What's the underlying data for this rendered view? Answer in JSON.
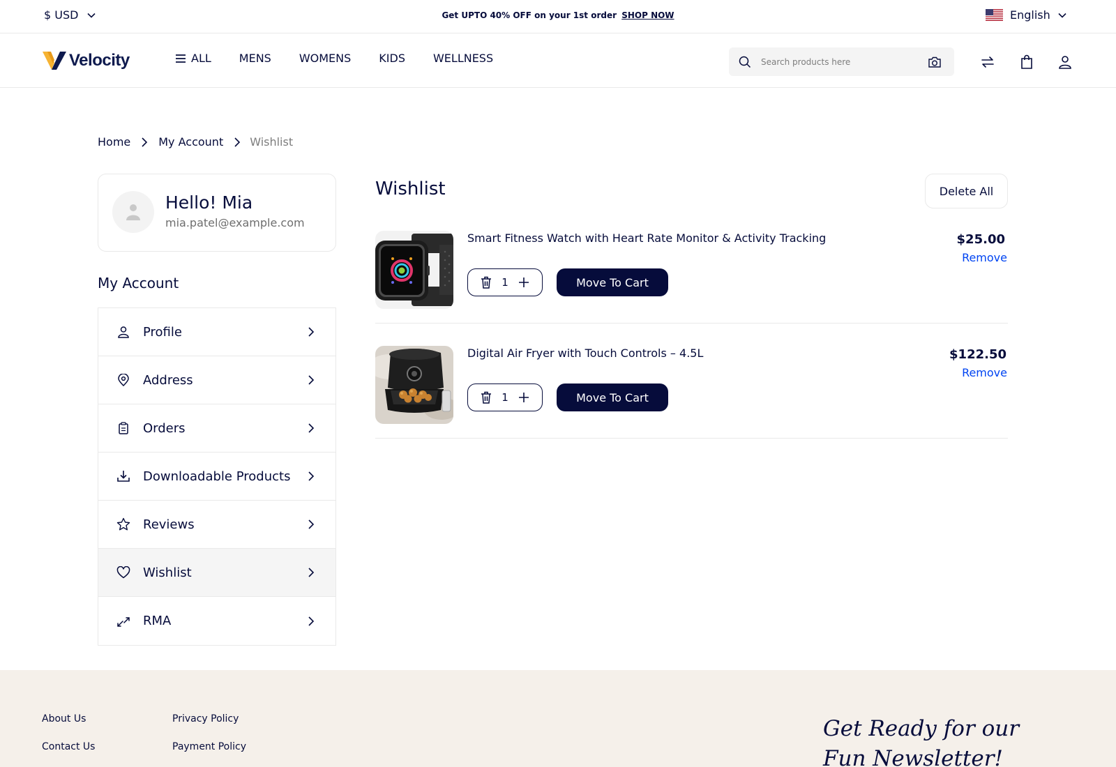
{
  "topbar": {
    "currency": "$ USD",
    "promo_text": "Get UPTO 40% OFF on your 1st order",
    "promo_link": "SHOP NOW",
    "language": "English"
  },
  "header": {
    "logo_text": "Velocity",
    "nav": [
      "ALL",
      "MENS",
      "WOMENS",
      "KIDS",
      "WELLNESS"
    ],
    "search_placeholder": "Search products here"
  },
  "breadcrumb": {
    "home": "Home",
    "account": "My Account",
    "current": "Wishlist"
  },
  "profile": {
    "greeting": "Hello! Mia",
    "email": "mia.patel@example.com"
  },
  "account_menu": {
    "title": "My Account",
    "items": [
      {
        "label": "Profile",
        "icon": "user-icon"
      },
      {
        "label": "Address",
        "icon": "location-pin-icon"
      },
      {
        "label": "Orders",
        "icon": "clipboard-icon"
      },
      {
        "label": "Downloadable Products",
        "icon": "download-icon"
      },
      {
        "label": "Reviews",
        "icon": "star-icon"
      },
      {
        "label": "Wishlist",
        "icon": "heart-icon",
        "active": true
      },
      {
        "label": "RMA",
        "icon": "arrows-exchange-icon"
      }
    ]
  },
  "wishlist": {
    "title": "Wishlist",
    "delete_all": "Delete All",
    "items": [
      {
        "name": "Smart Fitness Watch with Heart Rate Monitor & Activity Tracking",
        "quantity": "1",
        "move_label": "Move To Cart",
        "price": "$25.00",
        "remove_label": "Remove"
      },
      {
        "name": "Digital Air Fryer with Touch Controls – 4.5L",
        "quantity": "1",
        "move_label": "Move To Cart",
        "price": "$122.50",
        "remove_label": "Remove"
      }
    ]
  },
  "footer": {
    "links_col1": [
      "About Us",
      "Contact Us"
    ],
    "links_col2": [
      "Privacy Policy",
      "Payment Policy"
    ],
    "newsletter_line1": "Get Ready for our",
    "newsletter_line2": "Fun Newsletter!"
  },
  "colors": {
    "primary": "#060C3B",
    "link": "#0044F2",
    "footer_bg": "#F5F0EA",
    "border": "#E9E9E9"
  }
}
